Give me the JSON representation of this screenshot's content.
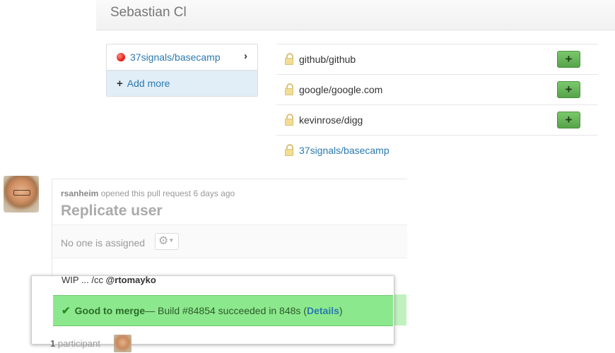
{
  "header": {
    "title": "Sebastian Cl"
  },
  "selected_repos": {
    "active": {
      "name": "37signals/basecamp",
      "status_color": "#e3241b"
    },
    "add_more_label": "Add more"
  },
  "repo_list": [
    {
      "name": "github/github",
      "has_add_button": true,
      "add_label": "+"
    },
    {
      "name": "google/google.com",
      "has_add_button": true,
      "add_label": "+"
    },
    {
      "name": "kevinrose/digg",
      "has_add_button": true,
      "add_label": "+"
    },
    {
      "name": "37signals/basecamp",
      "has_add_button": false
    }
  ],
  "pull_request": {
    "author": "rsanheim",
    "meta_text": "opened this pull request 6 days ago",
    "title": "Replicate user",
    "assignee_text": "No one is assigned",
    "body_prefix": "WIP ... /cc ",
    "mention": "@rtomayko",
    "merge_status": {
      "good_label": "Good to merge",
      "message": " — Build #84854 succeeded in 848s (",
      "details_label": "Details",
      "close_paren": ")",
      "color": "#8ce88c"
    },
    "participants_count": "1",
    "participants_label": "participant"
  },
  "colors": {
    "link": "#2a7ab0",
    "add_button": "#56a34a"
  }
}
